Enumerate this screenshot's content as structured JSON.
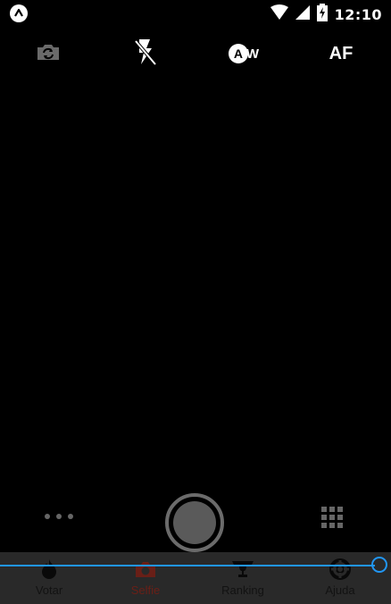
{
  "status_bar": {
    "time": "12:10",
    "icons": [
      "app-notification-icon",
      "wifi-icon",
      "cell-signal-icon",
      "battery-charging-icon"
    ]
  },
  "camera_controls": {
    "switch_camera_icon": "camera-switch-icon",
    "flash_icon": "flash-off-icon",
    "white_balance": {
      "badge": "A",
      "suffix": "W"
    },
    "autofocus_label": "AF"
  },
  "bottom_controls": {
    "more_icon": "more-horizontal-icon",
    "shutter_icon": "shutter-button",
    "grid_icon": "grid-icon"
  },
  "bottom_nav": {
    "items": [
      {
        "label": "Votar",
        "icon": "flame-icon",
        "active": false
      },
      {
        "label": "Selfie",
        "icon": "camera-icon",
        "active": true
      },
      {
        "label": "Ranking",
        "icon": "trophy-icon",
        "active": false
      },
      {
        "label": "Ajuda",
        "icon": "lifebuoy-icon",
        "active": false
      }
    ]
  },
  "colors": {
    "accent_active": "#c0392b",
    "slider": "#2196F3",
    "nav_background": "#4b4b4b"
  }
}
